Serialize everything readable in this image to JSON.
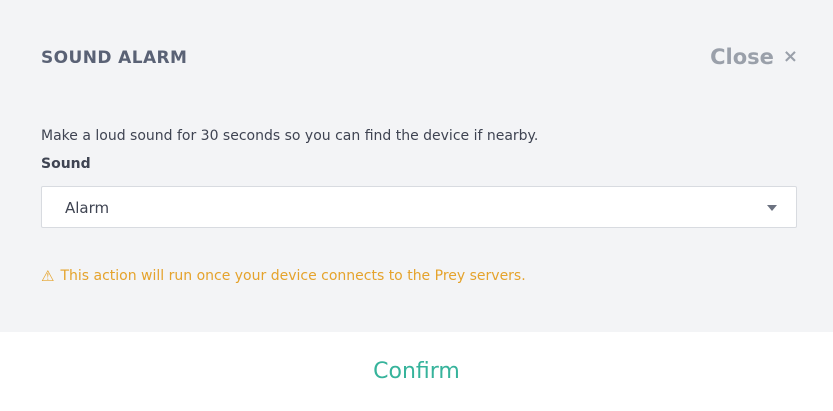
{
  "dialog": {
    "title": "SOUND ALARM",
    "close_label": "Close",
    "close_icon": "×"
  },
  "content": {
    "description": "Make a loud sound for 30 seconds so you can find the device if nearby.",
    "sound_label": "Sound",
    "sound_select": {
      "value": "Alarm"
    },
    "warning_icon": "⚠",
    "warning_text": "This action will run once your device connects to the Prey servers."
  },
  "footer": {
    "confirm_label": "Confirm"
  },
  "colors": {
    "panel_background": "#f3f4f6",
    "warning": "#e5a32c",
    "confirm": "#36b39b"
  }
}
